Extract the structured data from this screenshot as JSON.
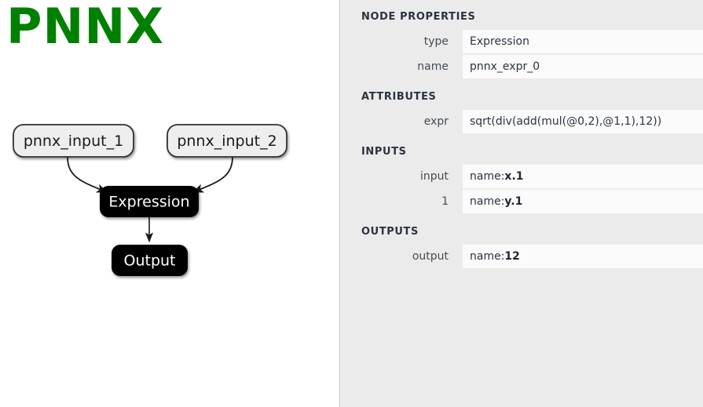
{
  "app": {
    "logo_text": "PNNX"
  },
  "graph": {
    "nodes": [
      {
        "id": "pnnx_input_1",
        "label": "pnnx_input_1",
        "style": "input"
      },
      {
        "id": "pnnx_input_2",
        "label": "pnnx_input_2",
        "style": "input"
      },
      {
        "id": "expression",
        "label": "Expression",
        "style": "op"
      },
      {
        "id": "output",
        "label": "Output",
        "style": "op"
      }
    ],
    "edges": [
      {
        "from": "pnnx_input_1",
        "to": "expression"
      },
      {
        "from": "pnnx_input_2",
        "to": "expression"
      },
      {
        "from": "expression",
        "to": "output"
      }
    ],
    "colors": {
      "input_fill": "#eeeeee",
      "input_border": "#333333",
      "op_fill": "#050505",
      "op_text": "#ffffff",
      "edge": "#1a1a1a"
    }
  },
  "properties_panel": {
    "sections": [
      {
        "header": "NODE PROPERTIES",
        "rows": [
          {
            "label": "type",
            "value": "Expression"
          },
          {
            "label": "name",
            "value": "pnnx_expr_0"
          }
        ]
      },
      {
        "header": "ATTRIBUTES",
        "rows": [
          {
            "label": "expr",
            "value": "sqrt(div(add(mul(@0,2),@1,1),12))"
          }
        ]
      },
      {
        "header": "INPUTS",
        "rows": [
          {
            "label": "input",
            "value_prefix": "name: ",
            "value_strong": "x.1"
          },
          {
            "label": "1",
            "value_prefix": "name: ",
            "value_strong": "y.1"
          }
        ]
      },
      {
        "header": "OUTPUTS",
        "rows": [
          {
            "label": "output",
            "value_prefix": "name: ",
            "value_strong": "12"
          }
        ]
      }
    ]
  },
  "colors": {
    "accent_green": "#008000",
    "panel_bg": "#ebebeb",
    "field_bg": "#fbfbfb",
    "header_text": "#2b3340"
  }
}
